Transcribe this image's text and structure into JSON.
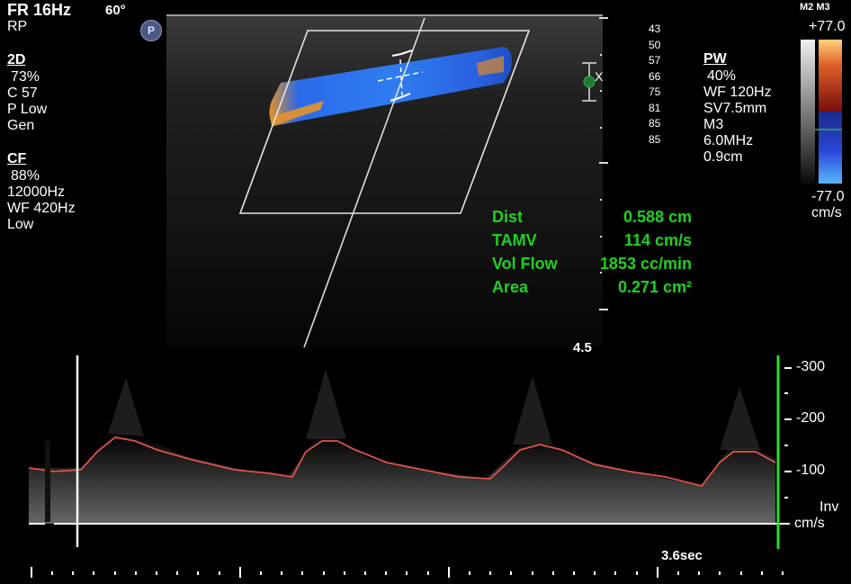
{
  "header": {
    "frame_rate": "FR 16Hz",
    "angle": "60°",
    "preset": "RP",
    "probe_badge": "P"
  },
  "mode_2d": {
    "title": "2D",
    "lines": [
      "73%",
      "C 57",
      "P Low",
      "Gen"
    ]
  },
  "mode_cf": {
    "title": "CF",
    "lines": [
      "88%",
      "12000Hz",
      "WF 420Hz",
      "Low"
    ]
  },
  "depth_numbers": [
    "43",
    "50",
    "57",
    "66",
    "75",
    "81",
    "85",
    "85"
  ],
  "marker_x": "X",
  "mode_pw": {
    "title": "PW",
    "lines": [
      "40%",
      "WF 120Hz",
      "SV7.5mm",
      "M3",
      "6.0MHz",
      "0.9cm"
    ]
  },
  "colorbar": {
    "mode_label": "M2 M3",
    "top_value": "+77.0",
    "bottom_value": "-77.0",
    "unit": "cm/s",
    "colors": {
      "positive_top": "#ffd27a",
      "positive_mid": "#c42a1a",
      "negative_mid": "#2a48d8",
      "negative_bottom": "#5ab6ff"
    }
  },
  "measurements": [
    {
      "label": "Dist",
      "value": "0.588 cm"
    },
    {
      "label": "TAMV",
      "value": "114 cm/s"
    },
    {
      "label": "Vol Flow",
      "value": "1853 cc/min"
    },
    {
      "label": "Area",
      "value": "0.271 cm²"
    }
  ],
  "depth_mark": "4.5",
  "spectral": {
    "scale_labels": [
      "-300",
      "-200",
      "-100"
    ],
    "inv_label": "Inv",
    "unit": "cm/s",
    "time_label": "3.6sec",
    "trace_color": "#e0534a",
    "baseline_color": "#ffffff",
    "cursor_color": "#2ddc2d"
  }
}
